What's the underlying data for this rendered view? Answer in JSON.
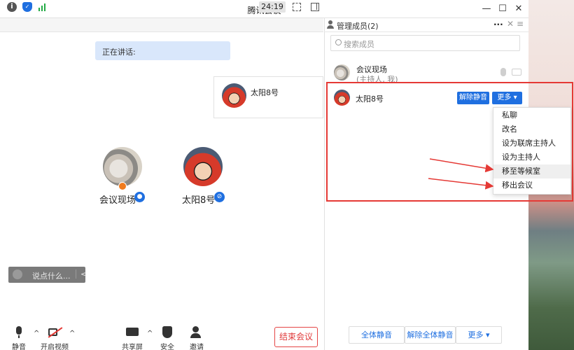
{
  "window": {
    "title": "腾讯会议",
    "minimize": "—",
    "maximize": "☐",
    "close": "✕"
  },
  "toolbar": {
    "timer": "24:19",
    "info_icon": "i",
    "shield_icon": "✓"
  },
  "stage": {
    "speaking_label": "正在讲话:",
    "tile_name": "太阳8号",
    "participants": [
      {
        "name": "会议现场"
      },
      {
        "name": "太阳8号"
      }
    ],
    "chat_placeholder": "说点什么...",
    "chat_collapse": "<"
  },
  "bottom_bar": {
    "mute": "静音",
    "video": "开启视频",
    "share": "共享屏幕",
    "security": "安全",
    "invite": "邀请",
    "end": "结束会议",
    "caret": "^"
  },
  "panel": {
    "title": "管理成员(2)",
    "more_dots": "···",
    "menu_icon": "≡",
    "search_placeholder": "搜索成员",
    "members": [
      {
        "name": "会议现场",
        "sub": "(主持人, 我)"
      },
      {
        "name": "太阳8号"
      }
    ],
    "unmute_btn": "解除静音",
    "more_btn": "更多",
    "dropdown": [
      "私聊",
      "改名",
      "设为联席主持人",
      "设为主持人",
      "移至等候室",
      "移出会议"
    ],
    "footer": {
      "mute_all": "全体静音",
      "unmute_all": "解除全体静音",
      "more": "更多"
    }
  },
  "colors": {
    "accent": "#1f6fe0",
    "danger": "#e53935",
    "speaking_bg": "#d9e7fb"
  }
}
